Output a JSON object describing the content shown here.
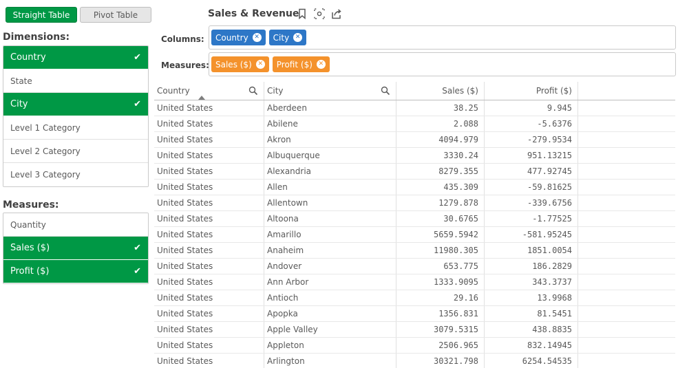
{
  "toggle": {
    "straight": "Straight Table",
    "pivot": "Pivot Table"
  },
  "dimensions": {
    "title": "Dimensions:",
    "items": [
      {
        "label": "Country",
        "selected": true
      },
      {
        "label": "State",
        "selected": false
      },
      {
        "label": "City",
        "selected": true
      },
      {
        "label": "Level 1 Category",
        "selected": false
      },
      {
        "label": "Level 2 Category",
        "selected": false
      },
      {
        "label": "Level 3 Category",
        "selected": false
      }
    ]
  },
  "measures": {
    "title": "Measures:",
    "items": [
      {
        "label": "Quantity",
        "selected": false
      },
      {
        "label": "Sales ($)",
        "selected": true
      },
      {
        "label": "Profit ($)",
        "selected": true
      }
    ]
  },
  "check_glyph": "✔",
  "header": {
    "title": "Sales & Revenue",
    "icons": [
      "bookmark-icon",
      "snapshot-icon",
      "export-icon"
    ]
  },
  "columns_field": {
    "label": "Columns:",
    "chips": [
      "Country",
      "City"
    ]
  },
  "measures_field": {
    "label": "Measures:",
    "chips": [
      "Sales ($)",
      "Profit ($)"
    ]
  },
  "chip_remove_glyph": "✕",
  "colors": {
    "accent_green": "#009845",
    "chip_blue": "#2d77c7",
    "chip_orange": "#f4922c"
  },
  "table": {
    "headers": [
      "Country",
      "City",
      "Sales ($)",
      "Profit ($)"
    ],
    "sort": {
      "column": "Country",
      "direction": "ascending"
    },
    "rows": [
      [
        "United States",
        "Aberdeen",
        "38.25",
        "9.945"
      ],
      [
        "United States",
        "Abilene",
        "2.088",
        "-5.6376"
      ],
      [
        "United States",
        "Akron",
        "4094.979",
        "-279.9534"
      ],
      [
        "United States",
        "Albuquerque",
        "3330.24",
        "951.13215"
      ],
      [
        "United States",
        "Alexandria",
        "8279.355",
        "477.92745"
      ],
      [
        "United States",
        "Allen",
        "435.309",
        "-59.81625"
      ],
      [
        "United States",
        "Allentown",
        "1279.878",
        "-339.6756"
      ],
      [
        "United States",
        "Altoona",
        "30.6765",
        "-1.77525"
      ],
      [
        "United States",
        "Amarillo",
        "5659.5942",
        "-581.95245"
      ],
      [
        "United States",
        "Anaheim",
        "11980.305",
        "1851.0054"
      ],
      [
        "United States",
        "Andover",
        "653.775",
        "186.2829"
      ],
      [
        "United States",
        "Ann Arbor",
        "1333.9095",
        "343.3737"
      ],
      [
        "United States",
        "Antioch",
        "29.16",
        "13.9968"
      ],
      [
        "United States",
        "Apopka",
        "1356.831",
        "81.5451"
      ],
      [
        "United States",
        "Apple Valley",
        "3079.5315",
        "438.8835"
      ],
      [
        "United States",
        "Appleton",
        "2506.965",
        "832.14945"
      ],
      [
        "United States",
        "Arlington",
        "30321.798",
        "6254.54535"
      ]
    ]
  }
}
